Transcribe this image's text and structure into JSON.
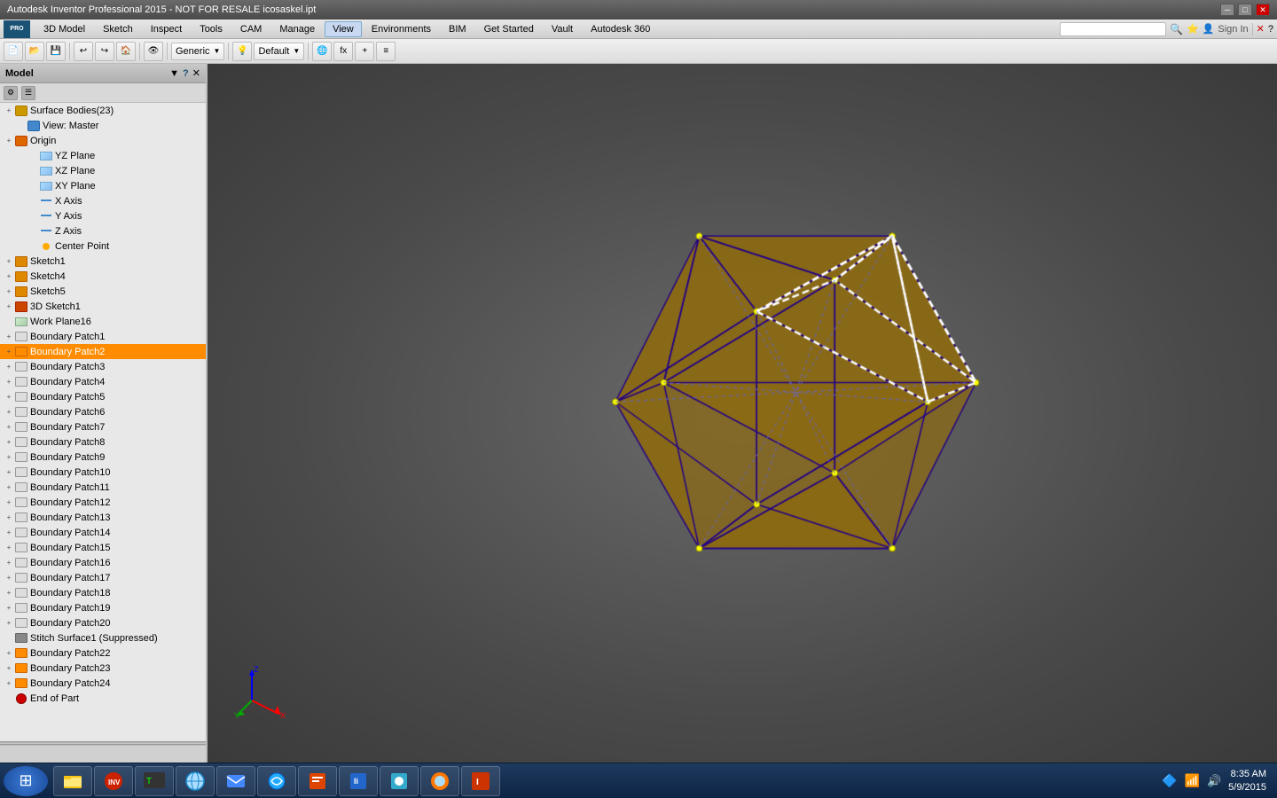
{
  "titleBar": {
    "title": "Autodesk Inventor Professional 2015 - NOT FOR RESALE  icosaskel.ipt",
    "controls": [
      "minimize",
      "restore",
      "close"
    ]
  },
  "menuBar": {
    "appLabel": "PRO",
    "items": [
      "3D Model",
      "Sketch",
      "Inspect",
      "Tools",
      "CAM",
      "Manage",
      "View",
      "Environments",
      "BIM",
      "Get Started",
      "Vault",
      "Autodesk 360"
    ]
  },
  "toolbar": {
    "dropdowns": [
      "Generic",
      "Default"
    ],
    "icons": [
      "new",
      "open",
      "save",
      "undo",
      "redo",
      "home",
      "view",
      "orbit"
    ]
  },
  "leftPanel": {
    "title": "Model",
    "dropdown": "▼",
    "treeItems": [
      {
        "id": "surface-bodies",
        "label": "Surface Bodies(23)",
        "indent": 0,
        "expand": "+",
        "icon": "surface-bodies",
        "selected": false
      },
      {
        "id": "view-master",
        "label": "View: Master",
        "indent": 1,
        "expand": "",
        "icon": "view",
        "selected": false
      },
      {
        "id": "origin",
        "label": "Origin",
        "indent": 0,
        "expand": "+",
        "icon": "origin",
        "selected": false
      },
      {
        "id": "yz-plane",
        "label": "YZ Plane",
        "indent": 2,
        "expand": "",
        "icon": "plane",
        "selected": false
      },
      {
        "id": "xz-plane",
        "label": "XZ Plane",
        "indent": 2,
        "expand": "",
        "icon": "plane",
        "selected": false
      },
      {
        "id": "xy-plane",
        "label": "XY Plane",
        "indent": 2,
        "expand": "",
        "icon": "plane",
        "selected": false
      },
      {
        "id": "x-axis",
        "label": "X Axis",
        "indent": 2,
        "expand": "",
        "icon": "axis",
        "selected": false
      },
      {
        "id": "y-axis",
        "label": "Y Axis",
        "indent": 2,
        "expand": "",
        "icon": "axis",
        "selected": false
      },
      {
        "id": "z-axis",
        "label": "Z Axis",
        "indent": 2,
        "expand": "",
        "icon": "axis",
        "selected": false
      },
      {
        "id": "center-point",
        "label": "Center Point",
        "indent": 2,
        "expand": "",
        "icon": "point",
        "selected": false
      },
      {
        "id": "sketch1",
        "label": "Sketch1",
        "indent": 0,
        "expand": "+",
        "icon": "sketch",
        "selected": false
      },
      {
        "id": "sketch4",
        "label": "Sketch4",
        "indent": 0,
        "expand": "+",
        "icon": "sketch",
        "selected": false
      },
      {
        "id": "sketch5",
        "label": "Sketch5",
        "indent": 0,
        "expand": "+",
        "icon": "sketch",
        "selected": false
      },
      {
        "id": "sketch3d1",
        "label": "3D Sketch1",
        "indent": 0,
        "expand": "+",
        "icon": "sketch3d",
        "selected": false
      },
      {
        "id": "workplane16",
        "label": "Work Plane16",
        "indent": 0,
        "expand": "",
        "icon": "workplane",
        "selected": false
      },
      {
        "id": "boundary-patch1",
        "label": "Boundary Patch1",
        "indent": 0,
        "expand": "+",
        "icon": "boundary",
        "selected": false
      },
      {
        "id": "boundary-patch2",
        "label": "Boundary Patch2",
        "indent": 0,
        "expand": "+",
        "icon": "boundary-orange",
        "selected": true
      },
      {
        "id": "boundary-patch3",
        "label": "Boundary Patch3",
        "indent": 0,
        "expand": "+",
        "icon": "boundary",
        "selected": false
      },
      {
        "id": "boundary-patch4",
        "label": "Boundary Patch4",
        "indent": 0,
        "expand": "+",
        "icon": "boundary",
        "selected": false
      },
      {
        "id": "boundary-patch5",
        "label": "Boundary Patch5",
        "indent": 0,
        "expand": "+",
        "icon": "boundary",
        "selected": false
      },
      {
        "id": "boundary-patch6",
        "label": "Boundary Patch6",
        "indent": 0,
        "expand": "+",
        "icon": "boundary",
        "selected": false
      },
      {
        "id": "boundary-patch7",
        "label": "Boundary Patch7",
        "indent": 0,
        "expand": "+",
        "icon": "boundary",
        "selected": false
      },
      {
        "id": "boundary-patch8",
        "label": "Boundary Patch8",
        "indent": 0,
        "expand": "+",
        "icon": "boundary",
        "selected": false
      },
      {
        "id": "boundary-patch9",
        "label": "Boundary Patch9",
        "indent": 0,
        "expand": "+",
        "icon": "boundary",
        "selected": false
      },
      {
        "id": "boundary-patch10",
        "label": "Boundary Patch10",
        "indent": 0,
        "expand": "+",
        "icon": "boundary",
        "selected": false
      },
      {
        "id": "boundary-patch11",
        "label": "Boundary Patch11",
        "indent": 0,
        "expand": "+",
        "icon": "boundary",
        "selected": false
      },
      {
        "id": "boundary-patch12",
        "label": "Boundary Patch12",
        "indent": 0,
        "expand": "+",
        "icon": "boundary",
        "selected": false
      },
      {
        "id": "boundary-patch13",
        "label": "Boundary Patch13",
        "indent": 0,
        "expand": "+",
        "icon": "boundary",
        "selected": false
      },
      {
        "id": "boundary-patch14",
        "label": "Boundary Patch14",
        "indent": 0,
        "expand": "+",
        "icon": "boundary",
        "selected": false
      },
      {
        "id": "boundary-patch15",
        "label": "Boundary Patch15",
        "indent": 0,
        "expand": "+",
        "icon": "boundary",
        "selected": false
      },
      {
        "id": "boundary-patch16",
        "label": "Boundary Patch16",
        "indent": 0,
        "expand": "+",
        "icon": "boundary",
        "selected": false
      },
      {
        "id": "boundary-patch17",
        "label": "Boundary Patch17",
        "indent": 0,
        "expand": "+",
        "icon": "boundary",
        "selected": false
      },
      {
        "id": "boundary-patch18",
        "label": "Boundary Patch18",
        "indent": 0,
        "expand": "+",
        "icon": "boundary",
        "selected": false
      },
      {
        "id": "boundary-patch19",
        "label": "Boundary Patch19",
        "indent": 0,
        "expand": "+",
        "icon": "boundary",
        "selected": false
      },
      {
        "id": "boundary-patch20",
        "label": "Boundary Patch20",
        "indent": 0,
        "expand": "+",
        "icon": "boundary",
        "selected": false
      },
      {
        "id": "stitch-surface1",
        "label": "Stitch Surface1 (Suppressed)",
        "indent": 0,
        "expand": "",
        "icon": "stitch",
        "selected": false
      },
      {
        "id": "boundary-patch22",
        "label": "Boundary Patch22",
        "indent": 0,
        "expand": "+",
        "icon": "boundary-orange",
        "selected": false
      },
      {
        "id": "boundary-patch23",
        "label": "Boundary Patch23",
        "indent": 0,
        "expand": "+",
        "icon": "boundary-orange",
        "selected": false
      },
      {
        "id": "boundary-patch24",
        "label": "Boundary Patch24",
        "indent": 0,
        "expand": "+",
        "icon": "boundary-orange",
        "selected": false
      },
      {
        "id": "end-of-part",
        "label": "End of Part",
        "indent": 0,
        "expand": "",
        "icon": "end",
        "selected": false
      }
    ]
  },
  "viewport": {
    "background": "#5a5a5a"
  },
  "taskbar": {
    "startIcon": "⊞",
    "items": [
      {
        "label": "Explorer",
        "icon": "📁"
      },
      {
        "label": "App",
        "icon": "🔴"
      },
      {
        "label": "Browser",
        "icon": "🌐"
      },
      {
        "label": "Mail",
        "icon": "📧"
      },
      {
        "label": "Network",
        "icon": "🔄"
      },
      {
        "label": "Tool1",
        "icon": "📊"
      },
      {
        "label": "Tool2",
        "icon": "📋"
      },
      {
        "label": "Tool3",
        "icon": "🔷"
      },
      {
        "label": "Browser2",
        "icon": "🦊"
      },
      {
        "label": "App2",
        "icon": "📌"
      }
    ],
    "systemTray": {
      "time": "8:35 AM",
      "date": "5/9/2015",
      "networkIcon": "📶",
      "soundIcon": "🔊",
      "batteryIcon": "🔋"
    }
  }
}
